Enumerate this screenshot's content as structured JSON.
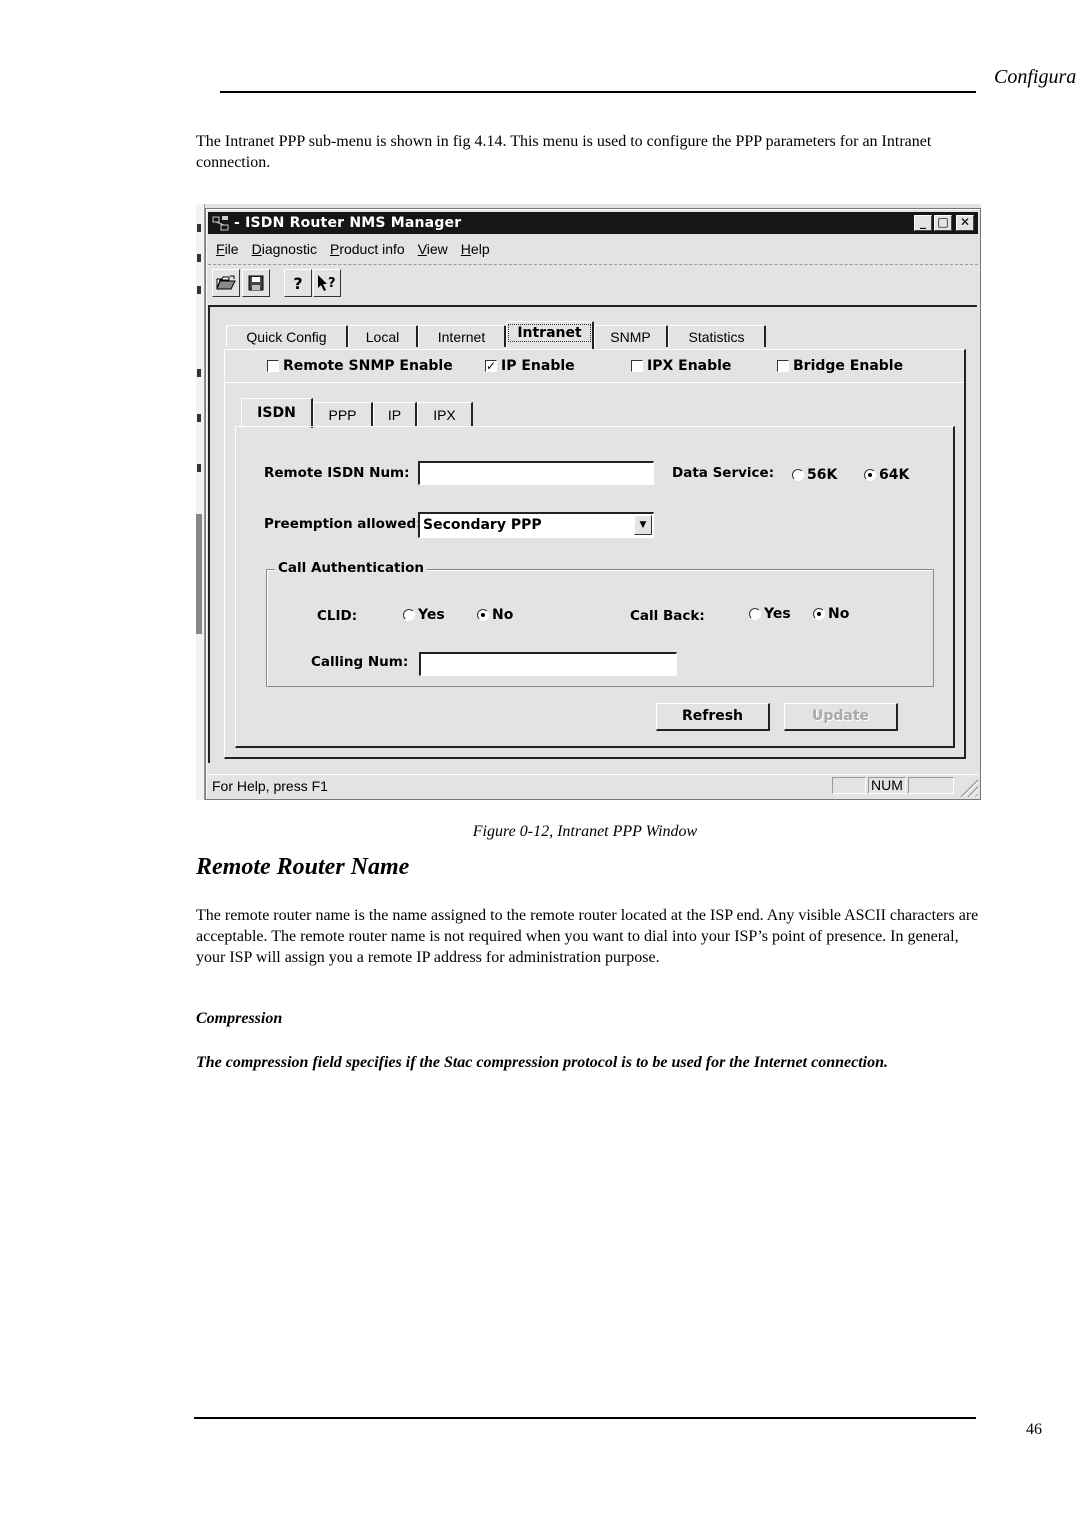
{
  "page": {
    "header_title": "Configura",
    "intro": "The Intranet PPP sub-menu is shown in fig 4.14. This menu is used to configure the PPP parameters for an Intranet connection.",
    "caption": "Figure 0-12, Intranet PPP Window",
    "section_heading": "Remote Router Name",
    "section_body": "The remote router name is the name assigned to the remote router located at the ISP end. Any visible ASCII characters are acceptable. The remote router name is not required when you want to dial into your ISP’s point of presence. In general, your ISP will assign you a remote IP address for administration purpose.",
    "subheading": "Compression",
    "sub_body": "The compression field specifies if the Stac compression protocol is to be used for the Internet connection.",
    "page_number": "46"
  },
  "window": {
    "title": "- ISDN Router NMS Manager",
    "controls": {
      "minimize": "_",
      "maximize": "□",
      "close": "✕"
    },
    "menu": [
      {
        "label": "File",
        "accel": "F",
        "rest": "ile"
      },
      {
        "label": "Diagnostic",
        "accel": "D",
        "rest": "iagnostic"
      },
      {
        "label": "Product info",
        "accel": "P",
        "rest": "roduct info"
      },
      {
        "label": "View",
        "accel": "V",
        "rest": "iew"
      },
      {
        "label": "Help",
        "accel": "H",
        "rest": "elp"
      }
    ],
    "toolbar": [
      {
        "icon": "open-folder-icon",
        "glyph": "📂"
      },
      {
        "icon": "save-disk-icon",
        "glyph": "💾"
      },
      {
        "icon": "help-icon",
        "glyph": "?"
      },
      {
        "icon": "context-help-icon",
        "glyph": "↖?"
      }
    ],
    "tabs": [
      "Quick Config",
      "Local",
      "Internet",
      "Intranet",
      "SNMP",
      "Statistics"
    ],
    "active_tab": "Intranet",
    "checkboxes": [
      {
        "label": "Remote SNMP Enable",
        "checked": false
      },
      {
        "label": "IP Enable",
        "checked": true
      },
      {
        "label": "IPX Enable",
        "checked": false
      },
      {
        "label": "Bridge Enable",
        "checked": false
      }
    ],
    "subtabs": [
      "ISDN",
      "PPP",
      "IP",
      "IPX"
    ],
    "active_subtab": "ISDN",
    "form": {
      "remote_isdn_label": "Remote ISDN Num:",
      "remote_isdn_value": "",
      "data_service_label": "Data Service:",
      "data_service_options": [
        "56K",
        "64K"
      ],
      "data_service_selected": "64K",
      "preemption_label": "Preemption allowed:",
      "preemption_value": "Secondary PPP",
      "call_auth_legend": "Call Authentication",
      "clid_label": "CLID:",
      "clid_options": [
        "Yes",
        "No"
      ],
      "clid_selected": "No",
      "callback_label": "Call Back:",
      "callback_options": [
        "Yes",
        "No"
      ],
      "callback_selected": "No",
      "calling_num_label": "Calling Num:",
      "calling_num_value": ""
    },
    "buttons": {
      "refresh": "Refresh",
      "update": "Update"
    },
    "status": {
      "text": "For Help, press F1",
      "num": "NUM"
    }
  }
}
